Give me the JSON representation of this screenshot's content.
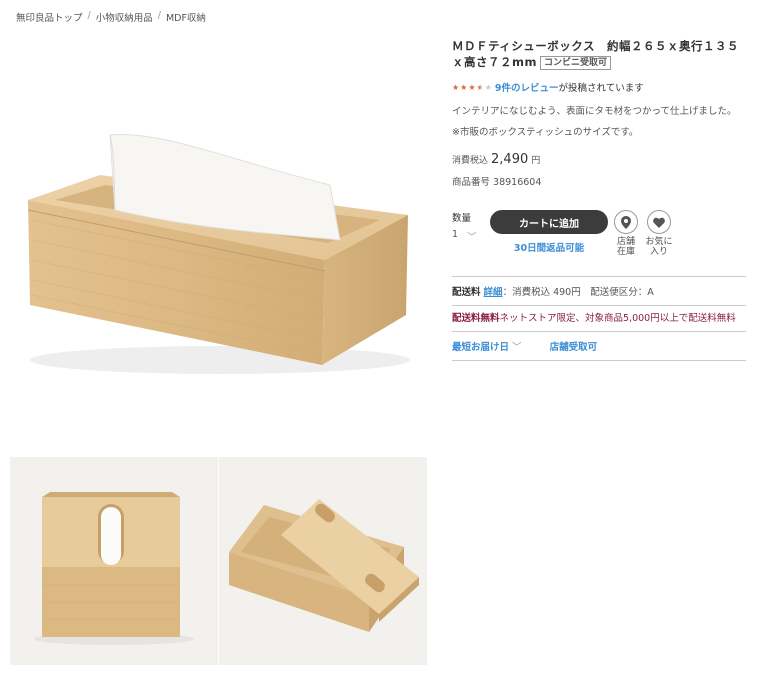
{
  "breadcrumb": {
    "items": [
      "無印良品トップ",
      "小物収納用品",
      "MDF収納"
    ],
    "separator": "/"
  },
  "product": {
    "title": "ＭＤＦティシューボックス　約幅２６５ｘ奥行１３５ｘ高さ７２mm",
    "pickup_badge": "コンビニ受取可",
    "rating": {
      "stars_filled": 3.5,
      "stars_total": 5
    },
    "review_link": "9件のレビュー",
    "review_suffix": "が投稿されています",
    "description": "インテリアになじむよう、表面にタモ材をつかって仕上げました。",
    "note": "※市販のボックスティッシュのサイズです。",
    "price_label": "消費税込",
    "price_value": "2,490",
    "price_unit": "円",
    "sku_label": "商品番号",
    "sku_value": "38916604"
  },
  "cart": {
    "qty_label": "数量",
    "qty_value": "1",
    "add_to_cart": "カートに追加",
    "return_note": "30日間返品可能",
    "store_stock_label": "店舗在庫",
    "favorite_label": "お気に入り"
  },
  "shipping": {
    "label": "配送料",
    "detail_link": "詳細",
    "text": "：消費税込 490円　配送便区分：A",
    "free_label": "配送料無料",
    "free_text": "ネットストア限定、対象商品5,000円以上で配送料無料",
    "fastest_delivery": "最短お届け日",
    "store_pickup": "店舗受取可"
  },
  "colors": {
    "link": "#3e8dd6",
    "star": "#d4693a",
    "cart_button": "#3c3c3c",
    "free_shipping": "#8b2040"
  }
}
